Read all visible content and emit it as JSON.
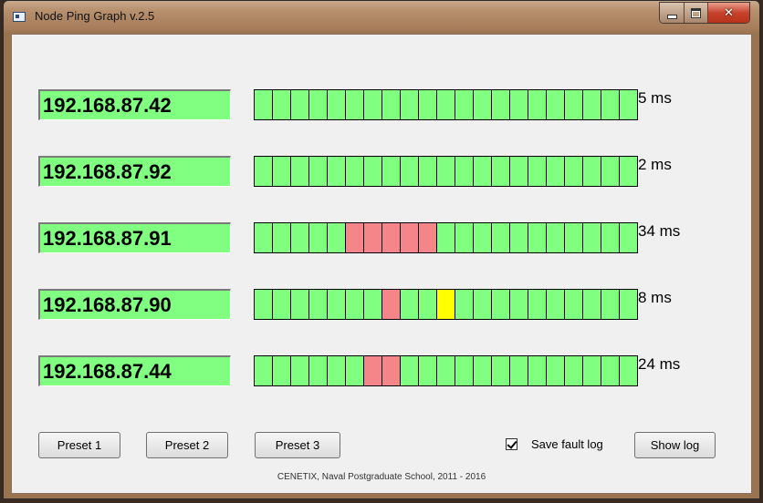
{
  "window": {
    "title": "Node Ping Graph  v.2.5"
  },
  "nodes": [
    {
      "ip": "192.168.87.42",
      "latency": "5 ms",
      "cells": [
        "ok",
        "ok",
        "ok",
        "ok",
        "ok",
        "ok",
        "ok",
        "ok",
        "ok",
        "ok",
        "ok",
        "ok",
        "ok",
        "ok",
        "ok",
        "ok",
        "ok",
        "ok",
        "ok",
        "ok",
        "ok"
      ]
    },
    {
      "ip": "192.168.87.92",
      "latency": "2 ms",
      "cells": [
        "ok",
        "ok",
        "ok",
        "ok",
        "ok",
        "ok",
        "ok",
        "ok",
        "ok",
        "ok",
        "ok",
        "ok",
        "ok",
        "ok",
        "ok",
        "ok",
        "ok",
        "ok",
        "ok",
        "ok",
        "ok"
      ]
    },
    {
      "ip": "192.168.87.91",
      "latency": "34 ms",
      "cells": [
        "ok",
        "ok",
        "ok",
        "ok",
        "ok",
        "fail",
        "fail",
        "fail",
        "fail",
        "fail",
        "ok",
        "ok",
        "ok",
        "ok",
        "ok",
        "ok",
        "ok",
        "ok",
        "ok",
        "ok",
        "ok"
      ]
    },
    {
      "ip": "192.168.87.90",
      "latency": "8 ms",
      "cells": [
        "ok",
        "ok",
        "ok",
        "ok",
        "ok",
        "ok",
        "ok",
        "fail",
        "ok",
        "ok",
        "warn",
        "ok",
        "ok",
        "ok",
        "ok",
        "ok",
        "ok",
        "ok",
        "ok",
        "ok",
        "ok"
      ]
    },
    {
      "ip": "192.168.87.44",
      "latency": "24 ms",
      "cells": [
        "ok",
        "ok",
        "ok",
        "ok",
        "ok",
        "ok",
        "fail",
        "fail",
        "ok",
        "ok",
        "ok",
        "ok",
        "ok",
        "ok",
        "ok",
        "ok",
        "ok",
        "ok",
        "ok",
        "ok",
        "ok"
      ]
    }
  ],
  "colors": {
    "ok": "#80ff80",
    "fail": "#f4868a",
    "warn": "#ffff00"
  },
  "buttons": {
    "preset1": "Preset 1",
    "preset2": "Preset 2",
    "preset3": "Preset 3",
    "show_log": "Show log"
  },
  "save_fault_log": {
    "label": "Save fault log",
    "checked": true
  },
  "footer": "CENETIX, Naval Postgraduate School, 2011 - 2016"
}
